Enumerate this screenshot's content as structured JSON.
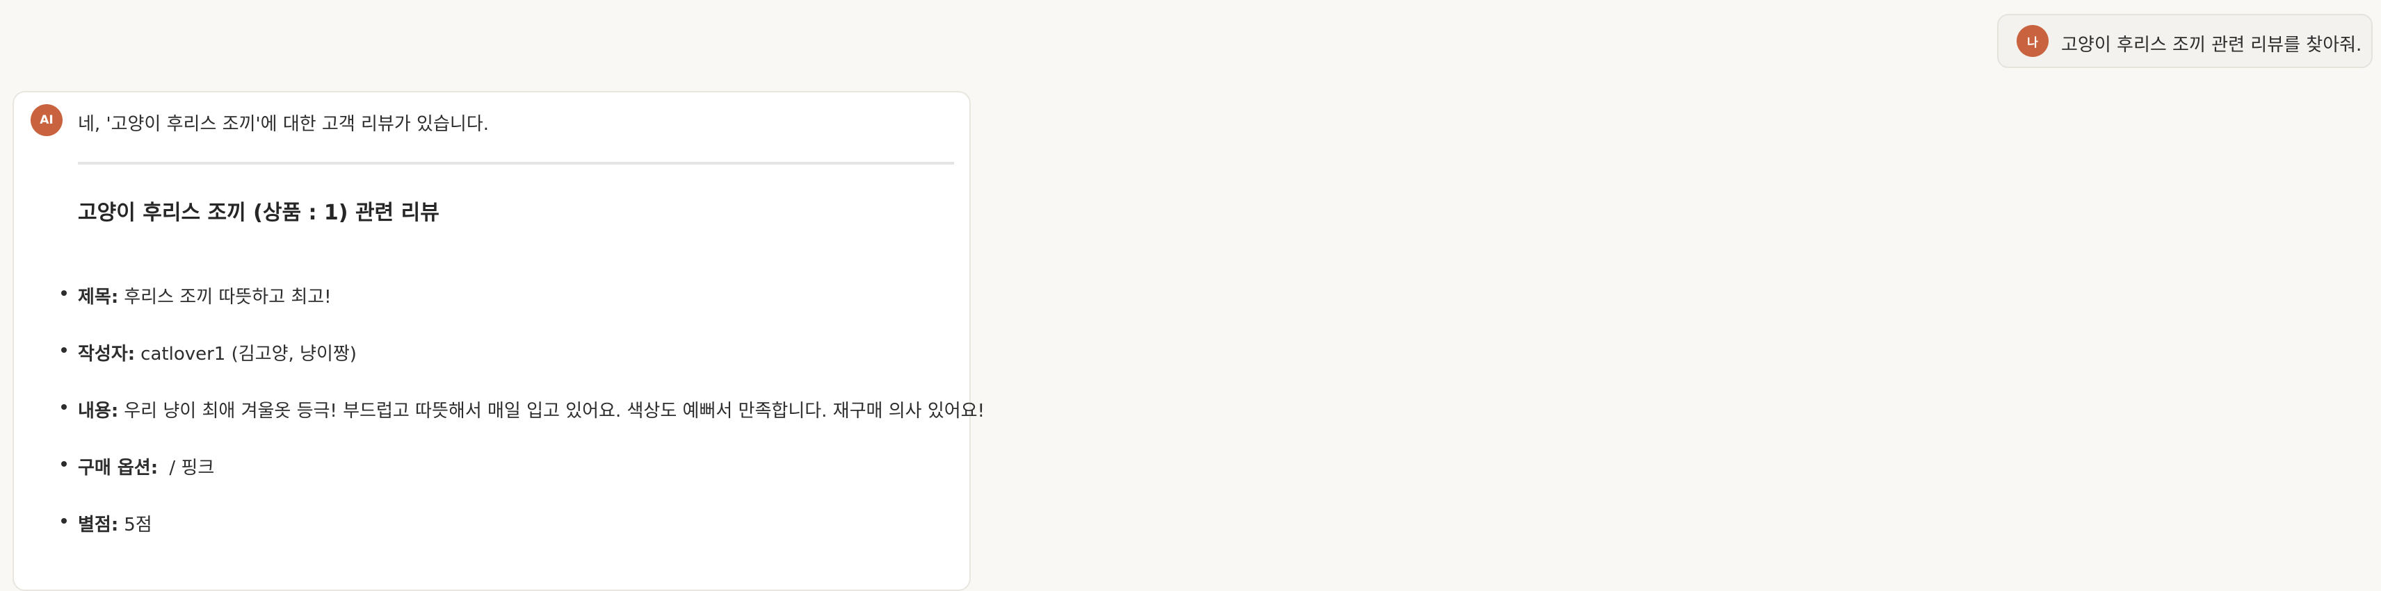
{
  "user_message": {
    "avatar_text": "나",
    "text": "고양이 후리스 조끼 관련 리뷰를 찾아줘."
  },
  "ai_message": {
    "avatar_text": "AI",
    "intro": "네, '고양이 후리스 조끼'에 대한 고객 리뷰가 있습니다.",
    "review_heading": "고양이 후리스 조끼 (상품 : 1) 관련 리뷰",
    "fields": [
      {
        "label": "제목:",
        "value": "후리스 조끼 따뜻하고 최고!"
      },
      {
        "label": "작성자:",
        "value": "catlover1 (김고양, 냥이짱)"
      },
      {
        "label": "내용:",
        "value": "우리 냥이 최애 겨울옷 등극! 부드럽고 따뜻해서 매일 입고 있어요. 색상도 예뻐서 만족합니다. 재구매 의사 있어요!"
      },
      {
        "label": "구매 옵션:",
        "value": " / 핑크"
      },
      {
        "label": "별점:",
        "value": "5점"
      }
    ]
  },
  "colors": {
    "background": "#f9f8f5",
    "avatar": "#c8623f",
    "card": "#ffffff"
  }
}
